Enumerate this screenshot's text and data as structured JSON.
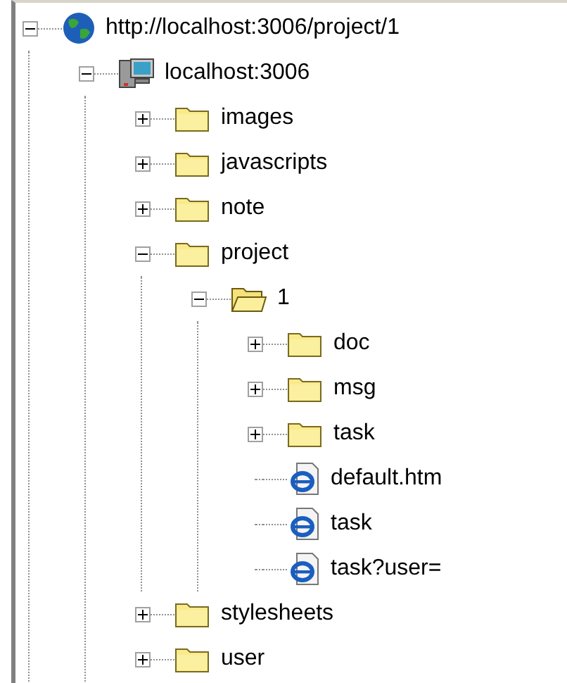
{
  "tree": [
    {
      "label": "http://localhost:3006/project/1",
      "kind": "site",
      "expanded": true,
      "children": [
        {
          "label": "localhost:3006",
          "kind": "host",
          "expanded": true,
          "children": [
            {
              "label": "images",
              "kind": "folder",
              "expanded": false
            },
            {
              "label": "javascripts",
              "kind": "folder",
              "expanded": false
            },
            {
              "label": "note",
              "kind": "folder",
              "expanded": false
            },
            {
              "label": "project",
              "kind": "folder",
              "expanded": true,
              "children": [
                {
                  "label": "1",
                  "kind": "open-folder",
                  "expanded": true,
                  "children": [
                    {
                      "label": "doc",
                      "kind": "folder",
                      "expanded": false
                    },
                    {
                      "label": "msg",
                      "kind": "folder",
                      "expanded": false
                    },
                    {
                      "label": "task",
                      "kind": "folder",
                      "expanded": false
                    },
                    {
                      "label": "default.htm",
                      "kind": "page"
                    },
                    {
                      "label": "task",
                      "kind": "page"
                    },
                    {
                      "label": "task?user=",
                      "kind": "page"
                    }
                  ]
                }
              ]
            },
            {
              "label": "stylesheets",
              "kind": "folder",
              "expanded": false
            },
            {
              "label": "user",
              "kind": "folder",
              "expanded": false
            }
          ]
        }
      ]
    }
  ]
}
